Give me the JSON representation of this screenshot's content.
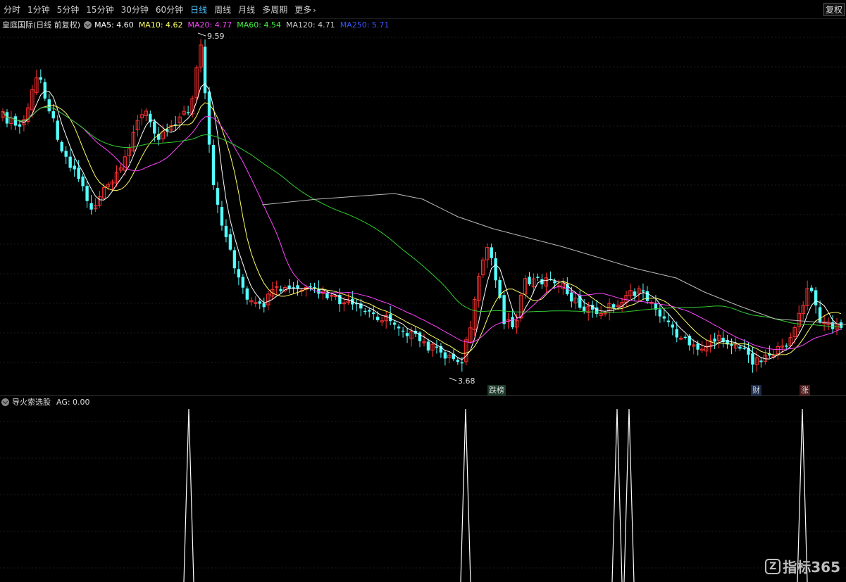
{
  "toolbar": {
    "periods": [
      "分时",
      "1分钟",
      "5分钟",
      "15分钟",
      "30分钟",
      "60分钟",
      "日线",
      "周线",
      "月线",
      "多周期",
      "更多"
    ],
    "active": "日线",
    "more_icon": "chevron-right-icon",
    "fq_label": "复权"
  },
  "ma_bar": {
    "title": "皇庭国际(日线 前复权)",
    "toggle_icon": "circle-chevron-down-icon",
    "items": [
      {
        "label": "MA5: 4.60",
        "color": "#ffffff"
      },
      {
        "label": "MA10: 4.62",
        "color": "#ffff66"
      },
      {
        "label": "MA20: 4.77",
        "color": "#ff44ff"
      },
      {
        "label": "MA60: 4.54",
        "color": "#44ee44"
      },
      {
        "label": "MA120: 4.71",
        "color": "#cccccc"
      },
      {
        "label": "MA250: 5.71",
        "color": "#3355ff"
      }
    ]
  },
  "chart_data": {
    "type": "candlestick",
    "high_label": "9.59",
    "low_label": "3.68",
    "colors": {
      "up": "#ff3232",
      "down": "#54ffff",
      "background": "#000000"
    }
  },
  "events": [
    {
      "label": "跌榜",
      "color": "#66ffcc"
    },
    {
      "label": "财",
      "color": "#66aaff"
    },
    {
      "label": "涨",
      "color": "#ff6666"
    }
  ],
  "indicator": {
    "toggle_icon": "circle-chevron-down-icon",
    "name": "导火索选股",
    "value": "AG: 0.00"
  },
  "watermark": {
    "logo": "Z",
    "text": "指标365"
  }
}
